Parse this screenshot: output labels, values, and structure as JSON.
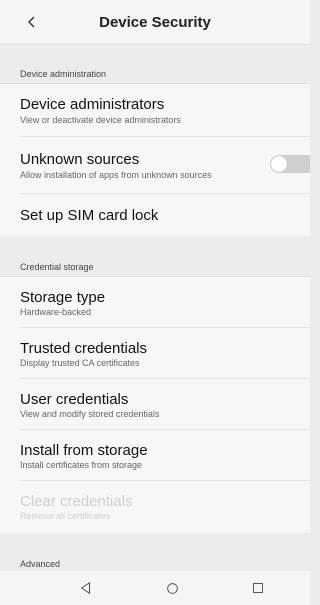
{
  "header": {
    "title": "Device Security",
    "back_icon": "chevron-left-icon"
  },
  "sections": {
    "device_admin": "Device administration",
    "credential_storage": "Credential storage",
    "advanced": "Advanced"
  },
  "items": {
    "device_administrators": {
      "title": "Device administrators",
      "subtitle": "View or deactivate device administrators"
    },
    "unknown_sources": {
      "title": "Unknown sources",
      "subtitle": "Allow installation of apps from unknown sources",
      "toggle_on": false
    },
    "sim_lock": {
      "title": "Set up SIM card lock"
    },
    "storage_type": {
      "title": "Storage type",
      "subtitle": "Hardware-backed"
    },
    "trusted_credentials": {
      "title": "Trusted credentials",
      "subtitle": "Display trusted CA certificates"
    },
    "user_credentials": {
      "title": "User credentials",
      "subtitle": "View and modify stored credentials"
    },
    "install_from_storage": {
      "title": "Install from storage",
      "subtitle": "Install certificates from storage"
    },
    "clear_credentials": {
      "title": "Clear credentials",
      "subtitle": "Remove all certificates",
      "disabled": true
    }
  },
  "nav": {
    "back_icon": "triangle-back-icon",
    "home_icon": "circle-home-icon",
    "recents_icon": "square-recents-icon"
  },
  "colors": {
    "background": "#f5f5f5",
    "section_bg": "#ececec",
    "toggle_off": "#cfcfcf",
    "disabled_text": "#cfcfcf"
  }
}
